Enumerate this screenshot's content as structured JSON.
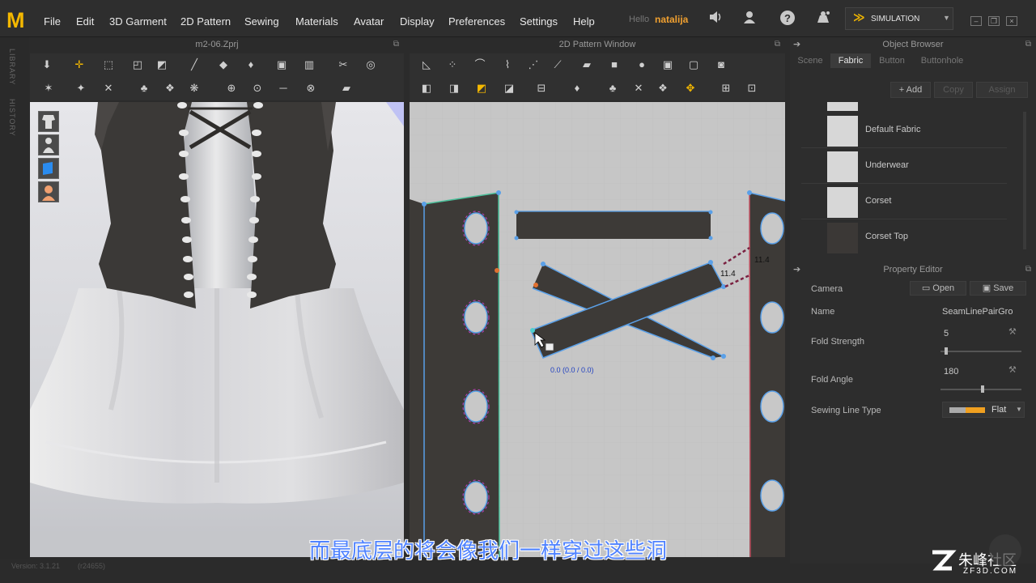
{
  "menubar": {
    "logo": "M",
    "items": [
      "File",
      "Edit",
      "3D Garment",
      "2D Pattern",
      "Sewing",
      "Materials",
      "Avatar",
      "Display",
      "Preferences",
      "Settings",
      "Help"
    ],
    "hello": "Hello",
    "user": "natalija",
    "simulation_label": "SIMULATION"
  },
  "left_strip": {
    "library": "LIBRARY",
    "history": "HISTORY"
  },
  "panels": {
    "view3d_title": "m2-06.Zprj",
    "view2d_title": "2D Pattern Window",
    "object_browser_title": "Object Browser",
    "property_editor_title": "Property Editor"
  },
  "object_browser": {
    "tabs": [
      "Scene",
      "Fabric",
      "Button",
      "Buttonhole"
    ],
    "active_tab": "Fabric",
    "add_label": "Add",
    "copy_label": "Copy",
    "assign_label": "Assign",
    "fabrics": [
      {
        "name": "Default Fabric",
        "color": "#d8d8d8"
      },
      {
        "name": "Underwear",
        "color": "#d8d8d8"
      },
      {
        "name": "Corset",
        "color": "#d8d8d8"
      },
      {
        "name": "Corset Top",
        "color": "#3b3836"
      }
    ]
  },
  "property_editor": {
    "camera_label": "Camera",
    "open_label": "Open",
    "save_label": "Save",
    "name_label": "Name",
    "name_value": "SeamLinePairGro",
    "fold_strength_label": "Fold Strength",
    "fold_strength_value": "5",
    "fold_strength_fraction": 0.05,
    "fold_angle_label": "Fold Angle",
    "fold_angle_value": "180",
    "fold_angle_fraction": 0.5,
    "sewing_line_type_label": "Sewing Line Type",
    "sewing_line_type_value": "Flat"
  },
  "pattern_view": {
    "measure_label": "11.4",
    "measure_label_2": "11.4",
    "coord_readout": "0.0 (0.0 / 0.0)"
  },
  "status": {
    "version": "Version: 3.1.21",
    "build": "(r24655)"
  },
  "subtitle": "而最底层的将会像我们一样穿过这些洞",
  "watermark": {
    "brand": "朱峰社区",
    "url": "ZF3D.COM"
  },
  "colors": {
    "accent": "#f4b800",
    "user": "#f0a030",
    "subtitle": "#4f82ff",
    "fabric_dark": "#3d3a37",
    "seam_blue": "#5aa0e8"
  }
}
